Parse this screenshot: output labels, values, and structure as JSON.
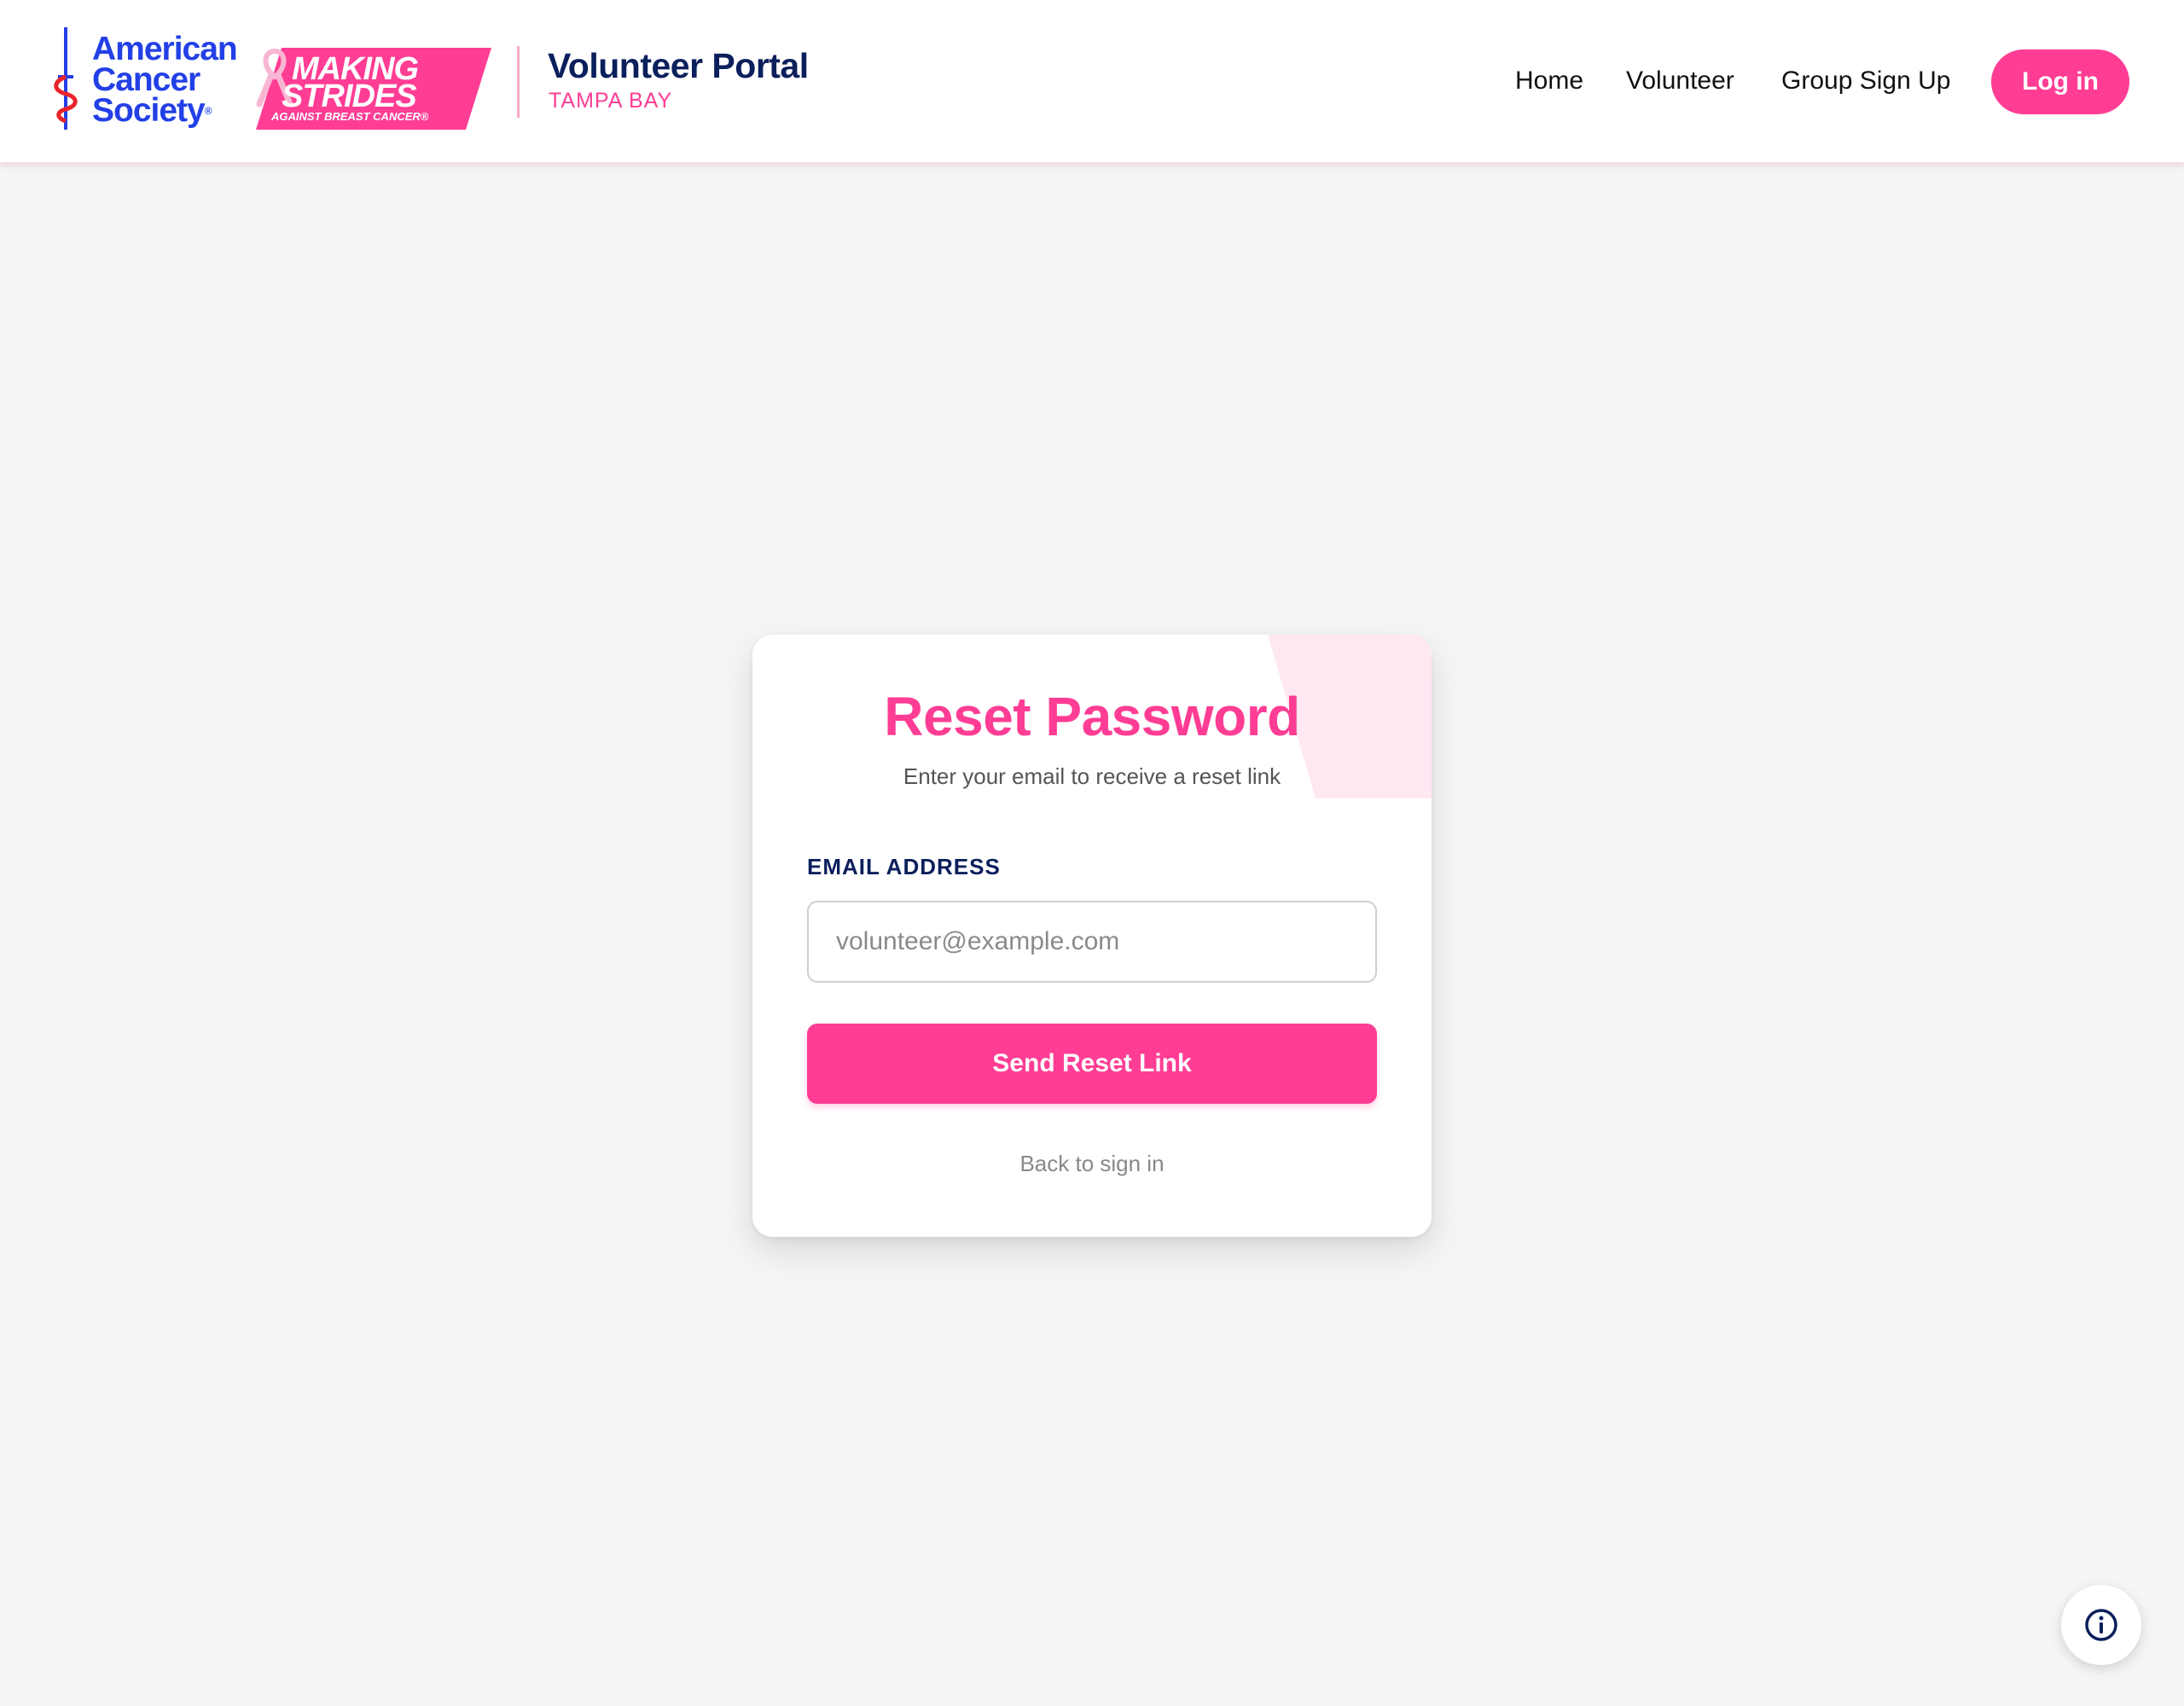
{
  "header": {
    "acs_logo": {
      "line1": "American",
      "line2": "Cancer",
      "line3": "Society",
      "reg": "®"
    },
    "making_strides": {
      "line1": "MAKING",
      "line2": "STRIDES",
      "line3": "AGAINST BREAST CANCER®"
    },
    "portal_title": "Volunteer Portal",
    "portal_subtitle": "TAMPA BAY",
    "nav": {
      "home": "Home",
      "volunteer": "Volunteer",
      "group_sign_up": "Group Sign Up"
    },
    "login_label": "Log in"
  },
  "reset_card": {
    "title": "Reset Password",
    "subtitle": "Enter your email to receive a reset link",
    "email_label": "EMAIL ADDRESS",
    "email_value": "",
    "email_placeholder": "volunteer@example.com",
    "submit_label": "Send Reset Link",
    "back_link": "Back to sign in"
  },
  "colors": {
    "brand_pink": "#ff3d94",
    "navy": "#0b1f5c",
    "acs_blue": "#2340e6",
    "background": "#f5f5f5"
  },
  "icons": {
    "acs_logo": "sword-icon",
    "ribbon": "pink-ribbon-icon",
    "info": "info-icon"
  }
}
